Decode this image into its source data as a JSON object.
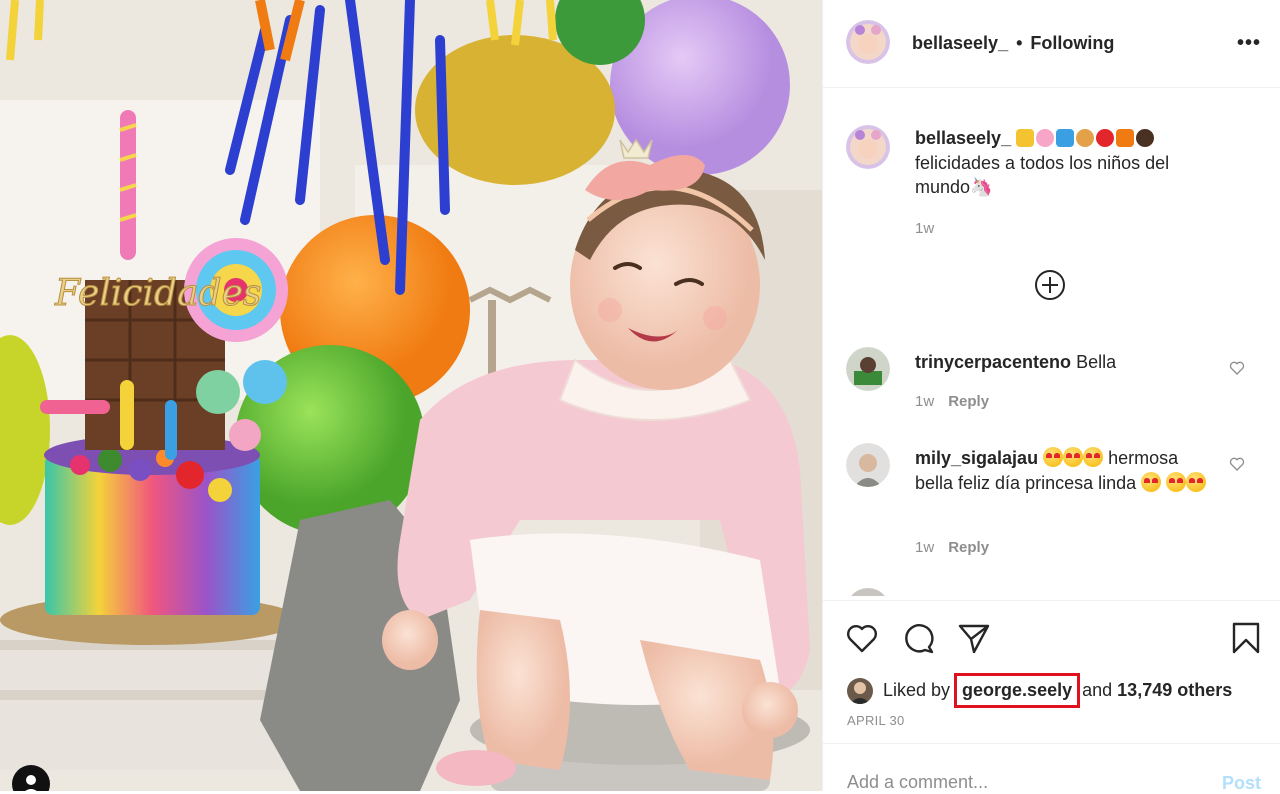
{
  "header": {
    "username": "bellaseely_",
    "separator": "•",
    "follow_status": "Following",
    "more_label": "•••"
  },
  "caption": {
    "username": "bellaseely_",
    "line1_rest": "",
    "text": "felicidades a todos los niños del mundo🦄",
    "time": "1w"
  },
  "comments": [
    {
      "username": "trinycerpacenteno",
      "text": "Bella",
      "time": "1w",
      "reply": "Reply"
    },
    {
      "username": "mily_sigalajau",
      "text_a": "hermosa bella feliz día princesa linda",
      "time": "1w",
      "reply": "Reply"
    }
  ],
  "likes": {
    "prefix": "Liked by",
    "user": "george.seely",
    "middle": "and",
    "count": "13,749 others"
  },
  "post_date": "APRIL 30",
  "add_comment": {
    "placeholder": "Add a comment...",
    "post_label": "Post"
  },
  "photo": {
    "cake_topper_text": "Felicidades"
  },
  "colors": {
    "highlight": "#e0111f",
    "post_disabled": "#b2dffc",
    "muted": "#8e8e8e"
  }
}
